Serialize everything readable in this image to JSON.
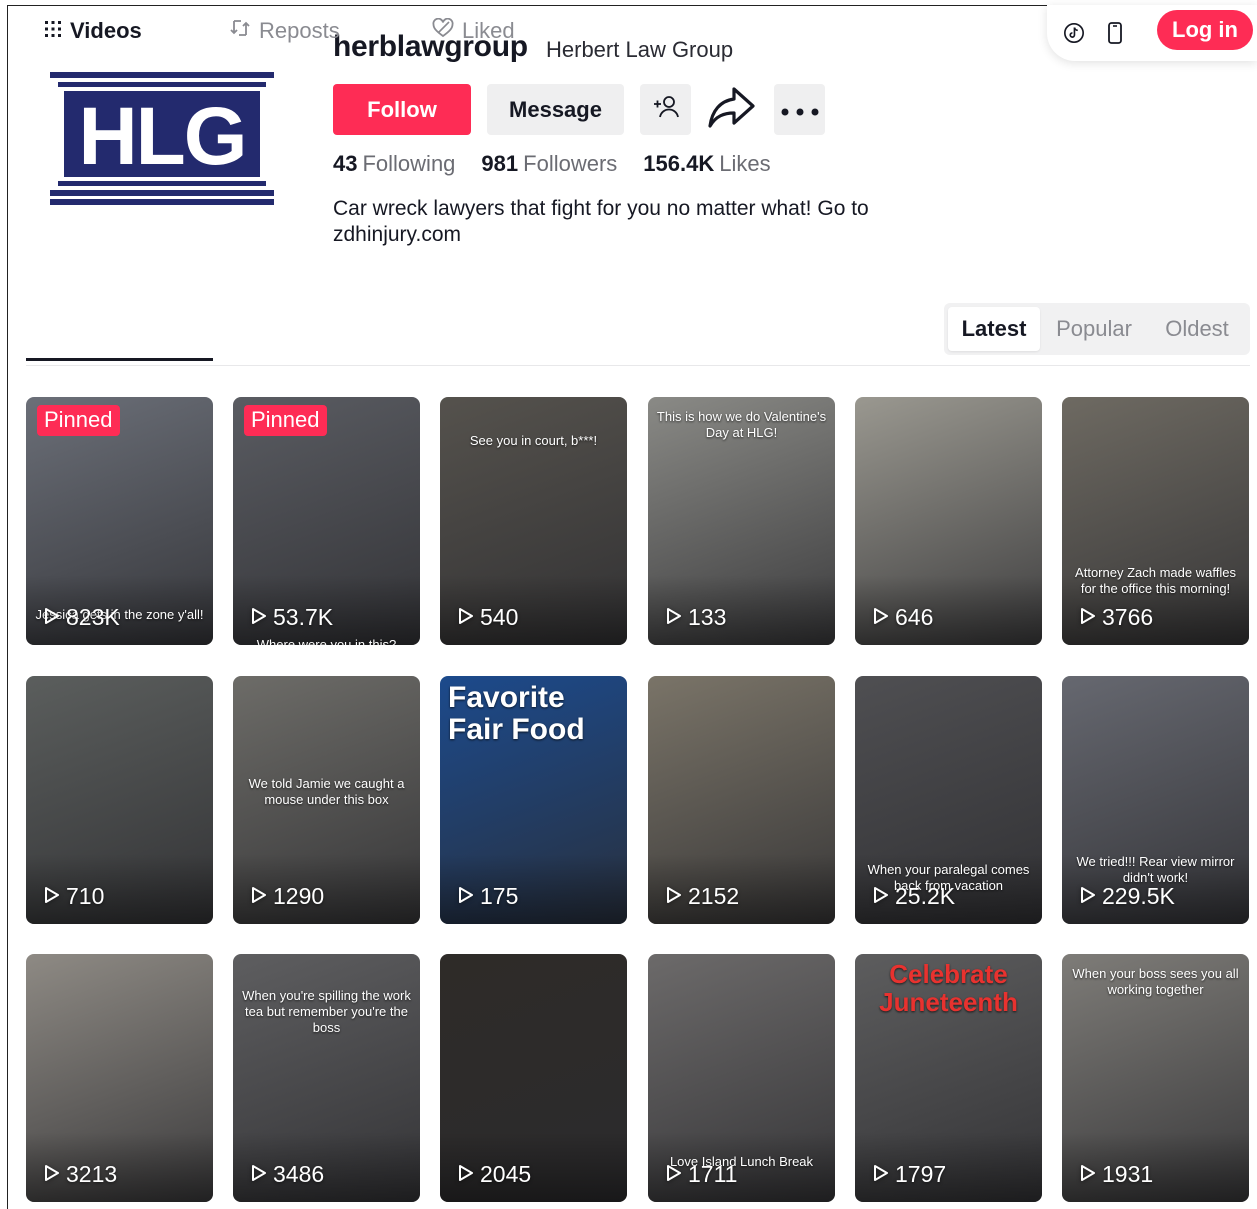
{
  "header": {
    "login_label": "Log in",
    "icons": [
      "tiktok-icon",
      "mobile-icon"
    ]
  },
  "profile": {
    "logo_text": "HLG",
    "username": "herblawgroup",
    "nickname": "Herbert Law Group",
    "follow_label": "Follow",
    "message_label": "Message",
    "stats": [
      {
        "value": "43",
        "label": "Following"
      },
      {
        "value": "981",
        "label": "Followers"
      },
      {
        "value": "156.4K",
        "label": "Likes"
      }
    ],
    "bio": "Car wreck lawyers that fight for you no matter what! Go to zdhinjury.com"
  },
  "tabs": [
    {
      "label": "Videos",
      "icon": "grid-icon",
      "active": true
    },
    {
      "label": "Reposts",
      "icon": "repost-icon",
      "active": false
    },
    {
      "label": "Liked",
      "icon": "heart-icon",
      "active": false
    }
  ],
  "sort": {
    "options": [
      "Latest",
      "Popular",
      "Oldest"
    ],
    "selected": "Latest"
  },
  "videos": [
    {
      "views": "823K",
      "pinned": true,
      "pinned_label": "Pinned",
      "caption": "Jessica gets in the zone y'all!",
      "bg": "#6b6f78"
    },
    {
      "views": "53.7K",
      "pinned": true,
      "pinned_label": "Pinned",
      "caption": "Where were you in this?",
      "bg": "#5a5c62"
    },
    {
      "views": "540",
      "pinned": false,
      "caption": "See you in court, b***!",
      "bg": "#55524d"
    },
    {
      "views": "133",
      "pinned": false,
      "caption": "This is how we do Valentine's Day at HLG!",
      "bg": "#8a8a86"
    },
    {
      "views": "646",
      "pinned": false,
      "caption": "",
      "bg": "#9a9890"
    },
    {
      "views": "3766",
      "pinned": false,
      "caption": "Attorney Zach made waffles for the office this morning!",
      "bg": "#6e6a62"
    },
    {
      "views": "710",
      "pinned": false,
      "caption": "",
      "bg": "#5b5e5d"
    },
    {
      "views": "1290",
      "pinned": false,
      "caption": "We told Jamie we caught a mouse under this box",
      "bg": "#6d6c68"
    },
    {
      "views": "175",
      "pinned": false,
      "caption": "Favorite Fair Food",
      "bg": "#1c4a8c"
    },
    {
      "views": "2152",
      "pinned": false,
      "caption": "",
      "bg": "#7a7468"
    },
    {
      "views": "25.2K",
      "pinned": false,
      "caption": "When your paralegal comes back from vacation",
      "bg": "#4f4f52"
    },
    {
      "views": "229.5K",
      "pinned": false,
      "caption": "We tried!!! Rear view mirror didn't work!",
      "bg": "#666870"
    },
    {
      "views": "3213",
      "pinned": false,
      "caption": "",
      "bg": "#8e8a84"
    },
    {
      "views": "3486",
      "pinned": false,
      "caption": "When you're spilling the work tea but remember you're the boss",
      "bg": "#5e5e60"
    },
    {
      "views": "2045",
      "pinned": false,
      "caption": "",
      "bg": "#2e2b28"
    },
    {
      "views": "1711",
      "pinned": false,
      "caption": "Love Island Lunch Break",
      "bg": "#6c6a6a"
    },
    {
      "views": "1797",
      "pinned": false,
      "caption": "Celebrate Juneteenth",
      "bg": "#5d5d5e"
    },
    {
      "views": "1931",
      "pinned": false,
      "caption": "When your boss sees you all working together",
      "bg": "#7e7c78"
    }
  ],
  "colors": {
    "accent": "#fe2c55",
    "text": "#161823",
    "muted": "#8a8b91",
    "logo_navy": "#232a6e"
  }
}
